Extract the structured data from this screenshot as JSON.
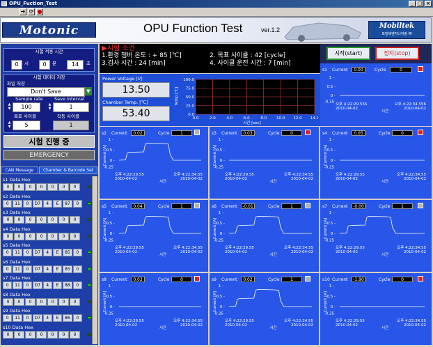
{
  "window": {
    "title": "OPU_Fuction_Test",
    "min": "_",
    "max": "□",
    "close": "×"
  },
  "toolbar": {
    "run": "➔",
    "run_cont": "⟳",
    "stop": "●"
  },
  "header": {
    "logo": "Motonic",
    "title": "OPU Function Test",
    "version": "ver.1.2",
    "partner": "Mobiltek",
    "partner_sub": "모빌텍엔지니어링 ㈜"
  },
  "left": {
    "set_time_label": "시험 적용 시간",
    "time": {
      "hour": "0",
      "h_unit": "시",
      "min": "0",
      "m_unit": "분",
      "sec": "14",
      "s_unit": "초"
    },
    "data_save_label": "시험 데이터 저장",
    "file_save_label": "파일 저장",
    "file_save_value": "Don't Save",
    "sample_rate_label": "Sample rate",
    "sample_rate": "100",
    "save_interval_label": "Save Interval",
    "save_interval": "1",
    "target_cycle_label": "목표 사이클",
    "target_cycle": "5",
    "run_cycle_label": "작동 사이클",
    "run_cycle": "1",
    "status": "시험 진행 중",
    "emergency": "EMERGENCY",
    "tab_can": "CAN Message",
    "tab_chamber": "Chamber & Barcode Set",
    "channels": [
      {
        "label": "s1 Data Hex",
        "cells": [
          "0",
          "0",
          "0",
          "0",
          "0",
          "0",
          "0"
        ],
        "led": false
      },
      {
        "label": "s2 Data Hex",
        "cells": [
          "0",
          "11",
          "0",
          "D7",
          "4",
          "E",
          "87",
          "0"
        ],
        "led": true
      },
      {
        "label": "s3 Data Hex",
        "cells": [
          "0",
          "0",
          "0",
          "0",
          "0",
          "0",
          "0"
        ],
        "led": false
      },
      {
        "label": "s4 Data Hex",
        "cells": [
          "0",
          "0",
          "0",
          "0",
          "0",
          "0",
          "0"
        ],
        "led": false
      },
      {
        "label": "s5 Data Hex",
        "cells": [
          "0",
          "11",
          "0",
          "D7",
          "4",
          "E",
          "85",
          "0"
        ],
        "led": true
      },
      {
        "label": "s6 Data Hex",
        "cells": [
          "0",
          "11",
          "0",
          "D7",
          "4",
          "E",
          "85",
          "0"
        ],
        "led": true
      },
      {
        "label": "s7 Data Hex",
        "cells": [
          "0",
          "11",
          "0",
          "D7",
          "4",
          "E",
          "88",
          "0"
        ],
        "led": true
      },
      {
        "label": "s8 Data Hex",
        "cells": [
          "0",
          "0",
          "0",
          "0",
          "0",
          "0",
          "0"
        ],
        "led": false
      },
      {
        "label": "s9 Data Hex",
        "cells": [
          "0",
          "11",
          "0",
          "D7",
          "4",
          "E",
          "86",
          "0"
        ],
        "led": true
      },
      {
        "label": "s10 Data Hex",
        "cells": [
          "0",
          "0",
          "0",
          "0",
          "0",
          "0",
          "0"
        ],
        "led": false
      }
    ]
  },
  "conditions": {
    "heading": "시험 조건",
    "line1a": "1.환경 챔버 온도 : + 85 [℃]",
    "line1b": "2. 목표 사이클 :      42 [cycle]",
    "line2a": "3.검사 시간 : 24 [min]",
    "line2b": "4. 사이클 운전 시간 : 7 [min]"
  },
  "buttons": {
    "start": "시작(start)",
    "stop": "정지(stop)"
  },
  "readouts": {
    "voltage_label": "Power Voltage [V]",
    "voltage": "13.50",
    "temp_label": "Chamber Temp. [℃]",
    "temp": "53.40"
  },
  "temp_chart": {
    "ylabel": "Temp [℃]",
    "xlabel": "시간 [sec]",
    "yticks": [
      "100.0",
      "75.0",
      "50.0",
      "25.0",
      "0.0"
    ],
    "xticks": [
      "0.0",
      "2.0",
      "4.0",
      "6.0",
      "8.0",
      "10.0",
      "12.0",
      "14.0"
    ]
  },
  "panels": [
    {
      "id": "s1",
      "current": "0.00",
      "cycle": "0",
      "ind": "r",
      "trace": "flat"
    },
    {
      "id": "s2",
      "current": "0.02",
      "cycle": "1",
      "ind": "g",
      "trace": "pulse"
    },
    {
      "id": "s3",
      "current": "0.03",
      "cycle": "0",
      "ind": "r",
      "trace": "flat"
    },
    {
      "id": "s4",
      "current": "0.05",
      "cycle": "0",
      "ind": "r",
      "trace": "flat"
    },
    {
      "id": "s5",
      "current": "0.04",
      "cycle": "1",
      "ind": "g",
      "trace": "pulse"
    },
    {
      "id": "s6",
      "current": "-0.01",
      "cycle": "1",
      "ind": "g",
      "trace": "pulse"
    },
    {
      "id": "s7",
      "current": "-0.00",
      "cycle": "1",
      "ind": "g",
      "trace": "pulse"
    },
    {
      "id": "s8",
      "current": "0.03",
      "cycle": "0",
      "ind": "r",
      "trace": "flat"
    },
    {
      "id": "s9",
      "current": "0.02",
      "cycle": "1",
      "ind": "g",
      "trace": "pulse"
    },
    {
      "id": "s10",
      "current": "-1.90",
      "cycle": "0",
      "ind": "r",
      "trace": "flat"
    }
  ],
  "panel_common": {
    "current_label": "Current",
    "cycle_label": "Cycle",
    "yaxis": "Current [A]",
    "y1": "1 -",
    "y05": "0.5 -",
    "y0": "0 -",
    "ymin": "-0.25",
    "xlabel": "시간",
    "tstart": "오후 4:22:29.55",
    "tend": "오후 4:22:34.55",
    "date": "2010-04-02",
    "s1_tstart": "오후 4:22:29.556",
    "s1_tend": "오후 4:22:34.556"
  },
  "colors": {
    "panel_bg": "#2856e8",
    "header_bg": "#f2f4fa",
    "left_bg": "#1f3fa8",
    "navy": "#141e82",
    "trace": "#ffffff"
  }
}
